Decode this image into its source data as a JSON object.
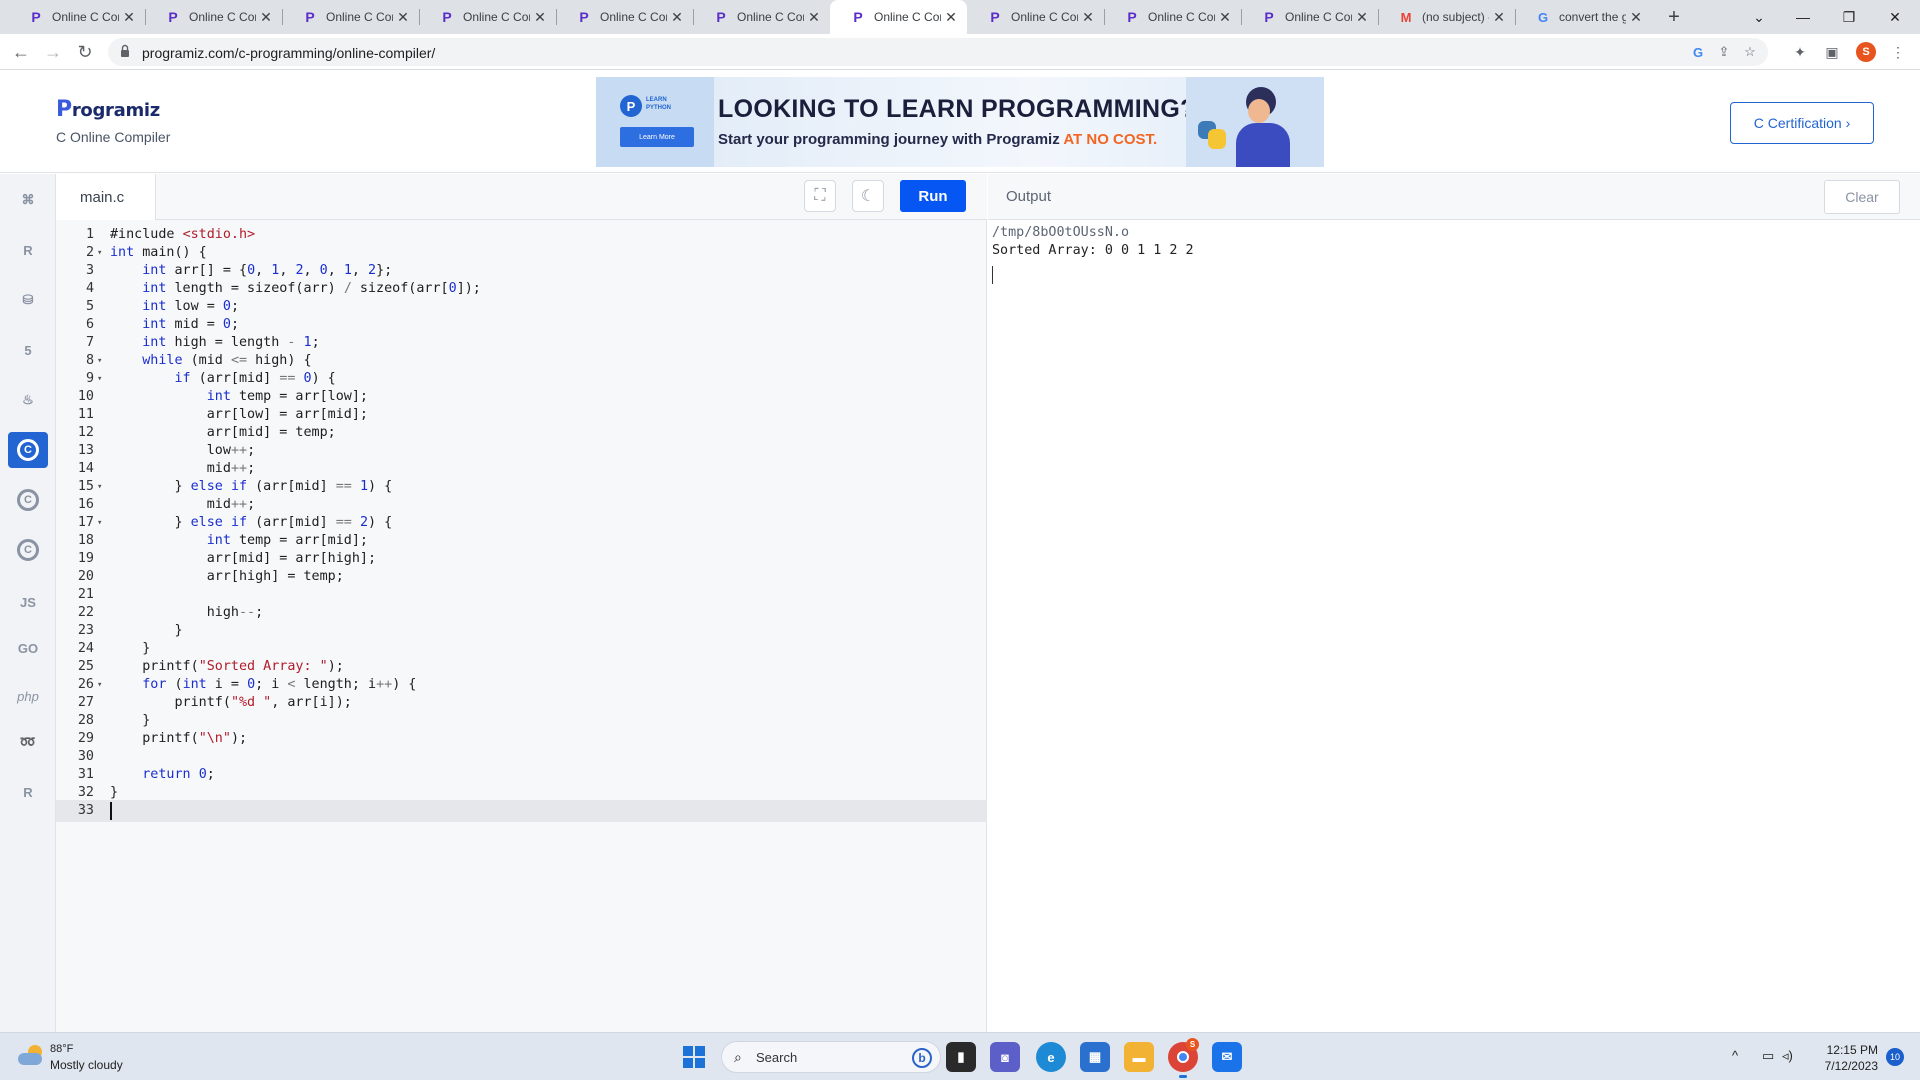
{
  "browser": {
    "tabs": [
      {
        "title": "Online C Com",
        "icon": "programiz-favicon",
        "active": false
      },
      {
        "title": "Online C Com",
        "icon": "programiz-favicon",
        "active": false
      },
      {
        "title": "Online C Com",
        "icon": "programiz-favicon",
        "active": false
      },
      {
        "title": "Online C Com",
        "icon": "programiz-favicon",
        "active": false
      },
      {
        "title": "Online C Com",
        "icon": "programiz-favicon",
        "active": false
      },
      {
        "title": "Online C Com",
        "icon": "programiz-favicon",
        "active": false
      },
      {
        "title": "Online C Com",
        "icon": "programiz-favicon",
        "active": true
      },
      {
        "title": "Online C Com",
        "icon": "programiz-favicon",
        "active": false
      },
      {
        "title": "Online C Com",
        "icon": "programiz-favicon",
        "active": false
      },
      {
        "title": "Online C Com",
        "icon": "programiz-favicon",
        "active": false
      },
      {
        "title": "(no subject) -",
        "icon": "gmail-favicon",
        "active": false
      },
      {
        "title": "convert the g",
        "icon": "google-favicon",
        "active": false
      }
    ],
    "url": "programiz.com/c-programming/online-compiler/",
    "profile_initial": "S"
  },
  "header": {
    "logo_text": "rogramiz",
    "logo_mark": "P",
    "subtitle": "C Online Compiler",
    "banner": {
      "badge": "P",
      "badge_label": "LEARN PYTHON",
      "button": "Learn More",
      "headline": "LOOKING TO LEARN PROGRAMMING?",
      "tagline": "Start your programming journey with Programiz ",
      "tagline_highlight": "AT NO COST."
    },
    "certification_button": "C Certification ›"
  },
  "sidebar": {
    "languages": [
      {
        "name": "python-icon",
        "glyph": "⌘",
        "active": false
      },
      {
        "name": "r-icon",
        "glyph": "R",
        "active": false
      },
      {
        "name": "sql-icon",
        "glyph": "⛁",
        "active": false
      },
      {
        "name": "html-icon",
        "glyph": "5",
        "active": false
      },
      {
        "name": "java-icon",
        "glyph": "♨",
        "active": false
      },
      {
        "name": "c-icon",
        "glyph": "C",
        "active": true
      },
      {
        "name": "cpp-icon",
        "glyph": "C",
        "active": false
      },
      {
        "name": "csharp-icon",
        "glyph": "C",
        "active": false
      },
      {
        "name": "javascript-icon",
        "glyph": "JS",
        "active": false
      },
      {
        "name": "go-icon",
        "glyph": "GO",
        "active": false
      },
      {
        "name": "php-icon",
        "glyph": "php",
        "active": false
      },
      {
        "name": "swift-icon",
        "glyph": "➿",
        "active": false
      },
      {
        "name": "rust-icon",
        "glyph": "R",
        "active": false
      }
    ]
  },
  "editor": {
    "file_name": "main.c",
    "run_label": "Run",
    "current_line": 33,
    "lines": [
      {
        "n": "1",
        "fold": false,
        "code": "#include <stdio.h>"
      },
      {
        "n": "2",
        "fold": true,
        "code": "int main() {"
      },
      {
        "n": "3",
        "fold": false,
        "code": "    int arr[] = {0, 1, 2, 0, 1, 2};"
      },
      {
        "n": "4",
        "fold": false,
        "code": "    int length = sizeof(arr) / sizeof(arr[0]);"
      },
      {
        "n": "5",
        "fold": false,
        "code": "    int low = 0;"
      },
      {
        "n": "6",
        "fold": false,
        "code": "    int mid = 0;"
      },
      {
        "n": "7",
        "fold": false,
        "code": "    int high = length - 1;"
      },
      {
        "n": "8",
        "fold": true,
        "code": "    while (mid <= high) {"
      },
      {
        "n": "9",
        "fold": true,
        "code": "        if (arr[mid] == 0) {"
      },
      {
        "n": "10",
        "fold": false,
        "code": "            int temp = arr[low];"
      },
      {
        "n": "11",
        "fold": false,
        "code": "            arr[low] = arr[mid];"
      },
      {
        "n": "12",
        "fold": false,
        "code": "            arr[mid] = temp;"
      },
      {
        "n": "13",
        "fold": false,
        "code": "            low++;"
      },
      {
        "n": "14",
        "fold": false,
        "code": "            mid++;"
      },
      {
        "n": "15",
        "fold": true,
        "code": "        } else if (arr[mid] == 1) {"
      },
      {
        "n": "16",
        "fold": false,
        "code": "            mid++;"
      },
      {
        "n": "17",
        "fold": true,
        "code": "        } else if (arr[mid] == 2) {"
      },
      {
        "n": "18",
        "fold": false,
        "code": "            int temp = arr[mid];"
      },
      {
        "n": "19",
        "fold": false,
        "code": "            arr[mid] = arr[high];"
      },
      {
        "n": "20",
        "fold": false,
        "code": "            arr[high] = temp;"
      },
      {
        "n": "21",
        "fold": false,
        "code": ""
      },
      {
        "n": "22",
        "fold": false,
        "code": "            high--;"
      },
      {
        "n": "23",
        "fold": false,
        "code": "        }"
      },
      {
        "n": "24",
        "fold": false,
        "code": "    }"
      },
      {
        "n": "25",
        "fold": false,
        "code": "    printf(\"Sorted Array: \");"
      },
      {
        "n": "26",
        "fold": true,
        "code": "    for (int i = 0; i < length; i++) {"
      },
      {
        "n": "27",
        "fold": false,
        "code": "        printf(\"%d \", arr[i]);"
      },
      {
        "n": "28",
        "fold": false,
        "code": "    }"
      },
      {
        "n": "29",
        "fold": false,
        "code": "    printf(\"\\n\");"
      },
      {
        "n": "30",
        "fold": false,
        "code": ""
      },
      {
        "n": "31",
        "fold": false,
        "code": "    return 0;"
      },
      {
        "n": "32",
        "fold": false,
        "code": "}"
      },
      {
        "n": "33",
        "fold": false,
        "code": ""
      }
    ]
  },
  "output": {
    "title": "Output",
    "clear_label": "Clear",
    "lines": [
      "/tmp/8bO0tOUssN.o",
      "Sorted Array: 0 0 1 1 2 2"
    ]
  },
  "taskbar": {
    "weather_temp": "88°F",
    "weather_desc": "Mostly cloudy",
    "search_placeholder": "Search",
    "time": "12:15 PM",
    "date": "7/12/2023",
    "notification_count": "10",
    "chrome_badge": "S"
  },
  "colors": {
    "accent": "#0556f3",
    "active_language": "#2264d1",
    "keyword": "#1a2ecf",
    "string": "#b11d2b"
  }
}
